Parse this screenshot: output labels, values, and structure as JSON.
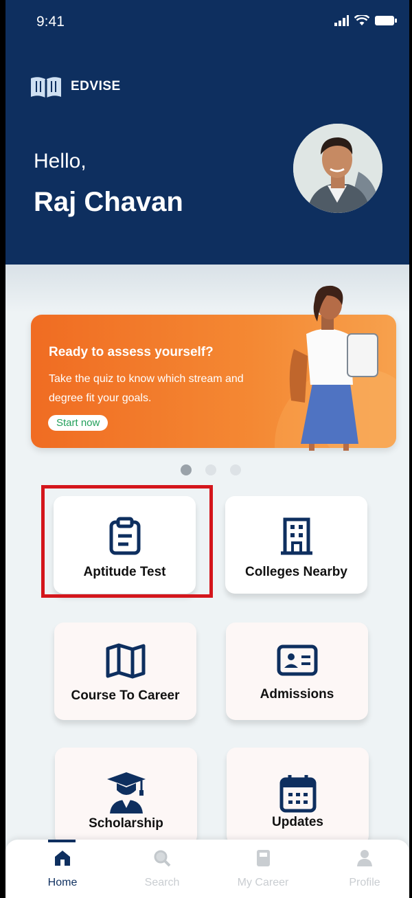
{
  "status_bar": {
    "time": "9:41"
  },
  "brand": {
    "name": "EDVISE"
  },
  "greeting": {
    "hello": "Hello,",
    "name": "Raj Chavan"
  },
  "banner": {
    "title": "Ready to assess yourself?",
    "subtitle": "Take the quiz to know which stream and degree fit your goals.",
    "cta": "Start now",
    "pages": 3,
    "active_page": 1
  },
  "tiles": [
    {
      "label": "Aptitude Test",
      "icon": "clipboard-icon"
    },
    {
      "label": "Colleges Nearby",
      "icon": "building-icon"
    },
    {
      "label": "Course To Career",
      "icon": "map-icon"
    },
    {
      "label": "Admissions",
      "icon": "id-card-icon"
    },
    {
      "label": "Scholarship",
      "icon": "graduate-icon"
    },
    {
      "label": "Updates",
      "icon": "calendar-icon"
    }
  ],
  "bottom_nav": [
    {
      "label": "Home",
      "icon": "home-icon",
      "active": true
    },
    {
      "label": "Search",
      "icon": "search-icon",
      "active": false
    },
    {
      "label": "My Career",
      "icon": "book-icon",
      "active": false
    },
    {
      "label": "Profile",
      "icon": "user-icon",
      "active": false
    }
  ],
  "colors": {
    "primary": "#0e2f5f",
    "accent_orange": "#f27a2b",
    "highlight": "#d4161c"
  }
}
